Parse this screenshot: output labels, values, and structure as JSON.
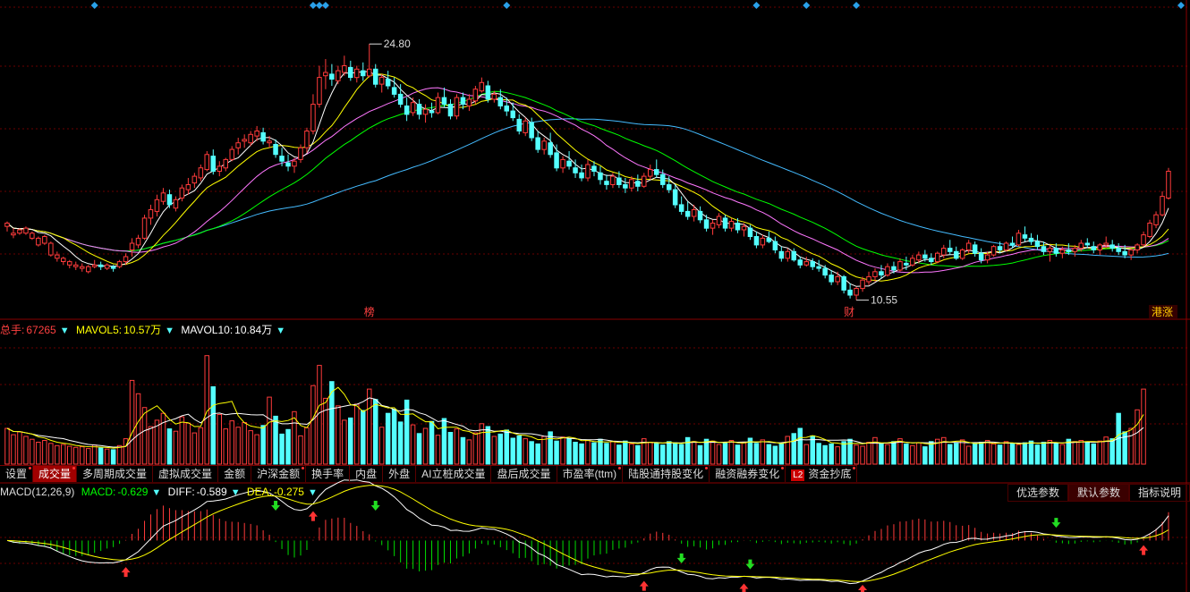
{
  "colors": {
    "up": "#ff3b3b",
    "down": "#54ffff",
    "ma5": "#ffffff",
    "ma10": "#ffff00",
    "ma20": "#ff77ff",
    "ma30": "#00ff00",
    "ma60": "#44bbff",
    "grid": "#6a0000",
    "diamond": "#2aa0e8"
  },
  "price_annotations": {
    "high_label": "24.80",
    "low_label": "10.55",
    "marker_bang": "榜",
    "marker_cai": "财",
    "marker_hk": "港涨"
  },
  "volume_legend": {
    "total_label": "总手:",
    "total_value": "67265",
    "mavol5_label": "MAVOL5:",
    "mavol5_value": "10.57万",
    "mavol10_label": "MAVOL10:",
    "mavol10_value": "10.84万"
  },
  "tabs": [
    {
      "label": "设置",
      "dot": true,
      "active": false
    },
    {
      "label": "成交量",
      "dot": true,
      "active": true
    },
    {
      "label": "多周期成交量",
      "dot": false,
      "active": false
    },
    {
      "label": "虚拟成交量",
      "dot": false,
      "active": false
    },
    {
      "label": "金额",
      "dot": false,
      "active": false
    },
    {
      "label": "沪深金额",
      "dot": true,
      "active": false
    },
    {
      "label": "换手率",
      "dot": false,
      "active": false
    },
    {
      "label": "内盘",
      "dot": false,
      "active": false
    },
    {
      "label": "外盘",
      "dot": false,
      "active": false
    },
    {
      "label": "AI立桩成交量",
      "dot": false,
      "active": false
    },
    {
      "label": "盘后成交量",
      "dot": false,
      "active": false
    },
    {
      "label": "市盈率(ttm)",
      "dot": true,
      "active": false
    },
    {
      "label": "陆股通持股变化",
      "dot": true,
      "active": false
    },
    {
      "label": "融资融券变化",
      "dot": true,
      "active": false
    },
    {
      "label": "资金抄底",
      "dot": true,
      "active": false,
      "badge": "L2"
    }
  ],
  "macd_legend": {
    "name": "MACD(12,26,9)",
    "macd_label": "MACD:",
    "macd_value": "-0.629",
    "diff_label": "DIFF:",
    "diff_value": "-0.589",
    "dea_label": "DEA:",
    "dea_value": "-0.275"
  },
  "macd_buttons": [
    "优选参数",
    "默认参数",
    "指标说明"
  ],
  "chart_data": {
    "type": "candlestick",
    "price_scale": [
      9,
      27
    ],
    "volume_scale": [
      0,
      22
    ],
    "macd_scale": [
      -1.5,
      1.2
    ],
    "grid": true,
    "candles": [
      [
        13.9,
        14.2,
        13.6,
        14.1
      ],
      [
        13.4,
        13.8,
        13.2,
        13.5
      ],
      [
        13.5,
        13.8,
        13.4,
        13.7
      ],
      [
        13.5,
        13.9,
        13.4,
        13.8
      ],
      [
        13.2,
        13.6,
        13.1,
        13.5
      ],
      [
        12.8,
        13.3,
        12.7,
        13.2
      ],
      [
        12.9,
        13.4,
        12.8,
        13.3
      ],
      [
        12.2,
        13.0,
        12.1,
        12.9
      ],
      [
        12.0,
        12.4,
        11.8,
        12.2
      ],
      [
        11.8,
        12.1,
        11.6,
        12.0
      ],
      [
        11.6,
        11.9,
        11.4,
        11.8
      ],
      [
        11.5,
        11.8,
        11.3,
        11.6
      ],
      [
        11.4,
        11.7,
        11.2,
        11.5
      ],
      [
        11.2,
        11.6,
        11.1,
        11.5
      ],
      [
        11.5,
        11.9,
        11.4,
        11.6
      ],
      [
        11.6,
        11.8,
        11.3,
        11.5
      ],
      [
        11.4,
        11.7,
        11.3,
        11.6
      ],
      [
        11.5,
        11.6,
        11.2,
        11.4
      ],
      [
        11.5,
        11.9,
        11.4,
        11.8
      ],
      [
        11.8,
        12.3,
        11.6,
        12.1
      ],
      [
        12.5,
        13.2,
        12.1,
        12.9
      ],
      [
        12.8,
        13.4,
        12.6,
        13.2
      ],
      [
        13.2,
        14.6,
        13.1,
        14.4
      ],
      [
        14.4,
        15.2,
        14.0,
        14.9
      ],
      [
        14.8,
        15.8,
        14.5,
        15.5
      ],
      [
        15.4,
        16.2,
        15.2,
        15.9
      ],
      [
        15.8,
        16.1,
        15.0,
        15.2
      ],
      [
        15.0,
        15.7,
        14.8,
        15.5
      ],
      [
        15.6,
        16.4,
        15.4,
        16.2
      ],
      [
        16.1,
        16.8,
        15.8,
        16.4
      ],
      [
        16.5,
        17.1,
        16.2,
        16.9
      ],
      [
        16.8,
        17.6,
        16.6,
        17.4
      ],
      [
        17.3,
        18.4,
        17.2,
        18.2
      ],
      [
        18.1,
        18.5,
        17.0,
        17.2
      ],
      [
        17.2,
        17.8,
        16.9,
        17.5
      ],
      [
        17.4,
        18.0,
        17.2,
        17.9
      ],
      [
        17.9,
        18.7,
        17.8,
        18.5
      ],
      [
        18.6,
        19.2,
        18.2,
        18.9
      ],
      [
        19.0,
        19.4,
        18.6,
        19.1
      ],
      [
        18.9,
        19.6,
        18.7,
        19.4
      ],
      [
        19.3,
        19.9,
        19.0,
        19.6
      ],
      [
        19.5,
        19.8,
        18.8,
        19.0
      ],
      [
        18.9,
        19.3,
        18.6,
        19.0
      ],
      [
        18.8,
        19.1,
        18.0,
        18.2
      ],
      [
        18.1,
        18.6,
        17.5,
        17.8
      ],
      [
        17.7,
        18.2,
        17.2,
        17.5
      ],
      [
        17.5,
        18.0,
        17.1,
        17.8
      ],
      [
        17.9,
        18.8,
        17.7,
        18.6
      ],
      [
        18.6,
        19.8,
        18.3,
        19.6
      ],
      [
        19.6,
        21.8,
        19.4,
        21.2
      ],
      [
        21.2,
        23.5,
        21.0,
        22.8
      ],
      [
        22.9,
        23.9,
        22.1,
        23.1
      ],
      [
        23.0,
        23.6,
        22.3,
        22.7
      ],
      [
        22.6,
        23.5,
        22.4,
        23.2
      ],
      [
        23.1,
        24.1,
        22.9,
        23.5
      ],
      [
        23.4,
        23.8,
        22.6,
        22.8
      ],
      [
        22.8,
        23.5,
        22.5,
        23.3
      ],
      [
        23.2,
        23.7,
        22.6,
        22.9
      ],
      [
        22.9,
        24.8,
        22.8,
        23.3
      ],
      [
        23.3,
        23.6,
        22.2,
        22.4
      ],
      [
        22.4,
        23.0,
        21.9,
        22.8
      ],
      [
        22.7,
        23.2,
        22.1,
        22.3
      ],
      [
        22.2,
        22.8,
        21.6,
        21.8
      ],
      [
        21.8,
        22.4,
        21.0,
        21.2
      ],
      [
        21.1,
        21.6,
        20.2,
        20.6
      ],
      [
        20.7,
        21.6,
        20.5,
        21.3
      ],
      [
        21.2,
        21.5,
        20.3,
        20.6
      ],
      [
        20.6,
        21.2,
        20.1,
        20.9
      ],
      [
        20.8,
        21.3,
        20.4,
        20.7
      ],
      [
        20.7,
        21.9,
        20.6,
        21.6
      ],
      [
        21.6,
        22.2,
        21.0,
        21.2
      ],
      [
        21.2,
        21.5,
        20.3,
        20.5
      ],
      [
        20.5,
        21.8,
        20.3,
        21.6
      ],
      [
        21.6,
        21.9,
        20.9,
        21.2
      ],
      [
        21.1,
        21.8,
        20.8,
        21.5
      ],
      [
        21.4,
        22.3,
        21.2,
        22.1
      ],
      [
        22.0,
        22.8,
        21.9,
        22.5
      ],
      [
        22.3,
        22.6,
        21.3,
        21.5
      ],
      [
        21.5,
        22.0,
        21.3,
        21.8
      ],
      [
        21.6,
        22.1,
        20.9,
        21.1
      ],
      [
        21.1,
        21.6,
        20.5,
        20.8
      ],
      [
        20.8,
        21.3,
        20.2,
        20.4
      ],
      [
        20.3,
        20.6,
        19.4,
        19.6
      ],
      [
        19.5,
        20.4,
        19.3,
        20.2
      ],
      [
        20.1,
        20.4,
        19.0,
        19.2
      ],
      [
        19.2,
        19.6,
        18.3,
        18.5
      ],
      [
        18.5,
        19.2,
        18.2,
        19.0
      ],
      [
        18.9,
        19.5,
        18.0,
        18.2
      ],
      [
        18.3,
        18.8,
        17.2,
        17.4
      ],
      [
        17.4,
        18.1,
        17.1,
        17.9
      ],
      [
        17.8,
        18.4,
        17.3,
        17.5
      ],
      [
        17.4,
        17.9,
        16.8,
        17.1
      ],
      [
        17.1,
        17.6,
        16.6,
        16.8
      ],
      [
        16.8,
        17.9,
        16.6,
        17.6
      ],
      [
        17.5,
        17.8,
        16.9,
        17.2
      ],
      [
        17.1,
        17.5,
        16.4,
        16.7
      ],
      [
        16.6,
        17.0,
        16.1,
        16.4
      ],
      [
        16.4,
        17.1,
        16.2,
        16.9
      ],
      [
        16.8,
        17.2,
        16.2,
        16.4
      ],
      [
        16.4,
        16.8,
        15.9,
        16.2
      ],
      [
        16.2,
        16.9,
        16.0,
        16.7
      ],
      [
        16.6,
        17.0,
        16.0,
        16.3
      ],
      [
        16.3,
        17.1,
        16.2,
        16.9
      ],
      [
        16.9,
        17.6,
        16.7,
        17.3
      ],
      [
        17.3,
        17.9,
        16.8,
        17.0
      ],
      [
        17.0,
        17.3,
        16.2,
        16.4
      ],
      [
        16.4,
        16.9,
        15.9,
        16.1
      ],
      [
        16.1,
        16.4,
        15.0,
        15.2
      ],
      [
        15.2,
        15.7,
        14.6,
        14.8
      ],
      [
        14.8,
        15.4,
        14.3,
        14.5
      ],
      [
        14.5,
        15.2,
        14.2,
        14.9
      ],
      [
        14.8,
        15.1,
        14.1,
        14.3
      ],
      [
        14.3,
        14.6,
        13.6,
        13.8
      ],
      [
        13.8,
        14.3,
        13.4,
        14.1
      ],
      [
        14.0,
        14.7,
        13.8,
        14.5
      ],
      [
        14.4,
        14.6,
        13.6,
        13.8
      ],
      [
        13.8,
        14.4,
        13.6,
        14.2
      ],
      [
        14.1,
        14.4,
        13.5,
        13.7
      ],
      [
        13.7,
        14.1,
        13.3,
        13.9
      ],
      [
        13.8,
        14.0,
        13.1,
        13.3
      ],
      [
        13.3,
        13.6,
        12.6,
        12.8
      ],
      [
        12.8,
        13.4,
        12.6,
        13.2
      ],
      [
        13.2,
        13.6,
        12.9,
        13.0
      ],
      [
        13.0,
        13.3,
        12.3,
        12.5
      ],
      [
        12.4,
        12.7,
        11.8,
        12.0
      ],
      [
        12.0,
        12.6,
        11.8,
        12.4
      ],
      [
        12.4,
        12.6,
        11.8,
        11.9
      ],
      [
        11.9,
        12.1,
        11.4,
        11.6
      ],
      [
        11.6,
        12.1,
        11.5,
        11.8
      ],
      [
        11.8,
        12.0,
        11.3,
        11.5
      ],
      [
        11.5,
        11.9,
        11.2,
        11.4
      ],
      [
        11.4,
        11.6,
        10.8,
        11.0
      ],
      [
        11.0,
        11.3,
        10.4,
        10.6
      ],
      [
        10.6,
        11.2,
        10.4,
        10.9
      ],
      [
        10.9,
        11.0,
        9.9,
        10.1
      ],
      [
        10.1,
        10.5,
        9.6,
        9.8
      ],
      [
        9.8,
        10.3,
        9.5,
        10.2
      ],
      [
        10.2,
        10.9,
        10.0,
        10.7
      ],
      [
        10.6,
        11.2,
        10.4,
        10.9
      ],
      [
        10.9,
        11.4,
        10.6,
        11.2
      ],
      [
        11.2,
        11.6,
        10.8,
        11.0
      ],
      [
        11.0,
        11.7,
        10.9,
        11.5
      ],
      [
        11.5,
        11.8,
        11.1,
        11.3
      ],
      [
        11.3,
        12.0,
        11.2,
        11.8
      ],
      [
        11.7,
        12.1,
        11.3,
        11.6
      ],
      [
        11.6,
        12.2,
        11.5,
        12.0
      ],
      [
        11.9,
        12.4,
        11.7,
        12.2
      ],
      [
        12.2,
        12.5,
        11.8,
        12.0
      ],
      [
        12.0,
        12.3,
        11.6,
        11.8
      ],
      [
        11.8,
        12.4,
        11.7,
        12.3
      ],
      [
        12.2,
        12.8,
        12.0,
        12.6
      ],
      [
        12.6,
        13.1,
        12.2,
        12.4
      ],
      [
        12.4,
        12.7,
        11.9,
        12.0
      ],
      [
        12.0,
        12.6,
        11.9,
        12.5
      ],
      [
        12.5,
        13.1,
        12.3,
        12.9
      ],
      [
        12.8,
        13.0,
        12.1,
        12.3
      ],
      [
        12.3,
        12.6,
        11.7,
        11.9
      ],
      [
        11.9,
        12.4,
        11.7,
        12.2
      ],
      [
        12.2,
        12.8,
        12.1,
        12.7
      ],
      [
        12.7,
        13.0,
        12.3,
        12.5
      ],
      [
        12.5,
        13.0,
        12.4,
        12.9
      ],
      [
        12.9,
        13.3,
        12.6,
        12.8
      ],
      [
        12.8,
        13.7,
        12.7,
        13.5
      ],
      [
        13.4,
        13.9,
        13.0,
        13.2
      ],
      [
        13.2,
        13.5,
        12.8,
        13.0
      ],
      [
        13.0,
        13.4,
        12.5,
        12.7
      ],
      [
        12.7,
        13.0,
        12.2,
        12.4
      ],
      [
        12.4,
        12.8,
        11.8,
        12.6
      ],
      [
        12.6,
        12.9,
        12.1,
        12.3
      ],
      [
        12.3,
        12.7,
        12.0,
        12.5
      ],
      [
        12.5,
        12.9,
        12.2,
        12.4
      ],
      [
        12.4,
        12.8,
        12.1,
        12.6
      ],
      [
        12.6,
        13.1,
        12.4,
        12.9
      ],
      [
        12.9,
        13.2,
        12.6,
        12.8
      ],
      [
        12.7,
        13.0,
        12.3,
        12.5
      ],
      [
        12.5,
        12.9,
        12.2,
        12.8
      ],
      [
        12.8,
        13.3,
        12.6,
        12.9
      ],
      [
        12.8,
        13.1,
        12.4,
        12.6
      ],
      [
        12.6,
        12.9,
        12.2,
        12.4
      ],
      [
        12.4,
        12.8,
        12.0,
        12.2
      ],
      [
        12.2,
        12.6,
        11.9,
        12.5
      ],
      [
        12.5,
        12.9,
        12.3,
        12.8
      ],
      [
        12.8,
        13.6,
        12.7,
        13.4
      ],
      [
        13.3,
        14.3,
        13.2,
        14.1
      ],
      [
        14.0,
        14.8,
        13.8,
        14.6
      ],
      [
        14.6,
        16.0,
        14.5,
        15.7
      ],
      [
        15.6,
        17.4,
        15.5,
        17.2
      ]
    ],
    "volume": [
      6.2,
      5.1,
      5.6,
      4.8,
      4.3,
      3.8,
      4.1,
      3.6,
      3.2,
      3.4,
      3.1,
      2.9,
      3.0,
      2.7,
      3.3,
      2.8,
      2.6,
      2.5,
      3.2,
      4.4,
      14.5,
      12.2,
      9.8,
      6.5,
      7.6,
      8.8,
      6.1,
      5.7,
      8.2,
      7.1,
      5.4,
      6.3,
      18.8,
      13.4,
      8.6,
      6.1,
      7.5,
      6.4,
      7.2,
      5.8,
      5.1,
      6.7,
      11.6,
      8.3,
      5.2,
      6.0,
      9.1,
      4.9,
      6.3,
      13.6,
      17.1,
      11.4,
      14.3,
      10.1,
      7.6,
      8.0,
      10.4,
      9.3,
      13.0,
      11.2,
      6.4,
      8.8,
      9.5,
      7.3,
      11.1,
      6.8,
      5.3,
      6.2,
      7.4,
      5.0,
      7.9,
      5.5,
      6.1,
      4.6,
      4.2,
      5.4,
      7.0,
      6.5,
      4.8,
      5.2,
      5.9,
      4.5,
      4.9,
      4.4,
      3.9,
      3.5,
      4.8,
      5.6,
      4.0,
      4.7,
      4.4,
      3.8,
      3.5,
      4.1,
      3.7,
      4.3,
      3.6,
      3.9,
      3.3,
      4.0,
      3.5,
      3.2,
      4.4,
      3.8,
      3.6,
      3.3,
      3.9,
      3.7,
      3.4,
      4.6,
      3.9,
      3.2,
      4.3,
      4.0,
      3.4,
      3.7,
      4.1,
      3.3,
      3.8,
      4.5,
      3.6,
      4.2,
      3.4,
      3.1,
      3.5,
      4.8,
      5.3,
      6.2,
      3.4,
      4.9,
      3.6,
      3.2,
      3.5,
      3.0,
      3.9,
      4.3,
      3.3,
      3.1,
      3.8,
      4.6,
      3.6,
      3.4,
      3.9,
      4.4,
      3.5,
      3.2,
      3.7,
      3.0,
      3.9,
      4.3,
      4.6,
      3.4,
      3.6,
      4.2,
      3.1,
      3.5,
      3.8,
      4.1,
      3.5,
      3.3,
      3.9,
      3.6,
      3.4,
      3.7,
      4.0,
      3.3,
      3.8,
      4.1,
      3.6,
      3.4,
      4.3,
      3.9,
      4.1,
      3.8,
      3.5,
      4.0,
      4.7,
      4.4,
      8.8,
      5.6,
      6.2,
      9.4,
      13.0
    ],
    "markers": {
      "high_index": 58,
      "low_index": 136,
      "bang_index": 58,
      "cai_index": 136,
      "diamond_indexes": [
        14,
        49,
        50,
        51,
        80,
        120,
        128,
        136,
        188
      ]
    }
  }
}
